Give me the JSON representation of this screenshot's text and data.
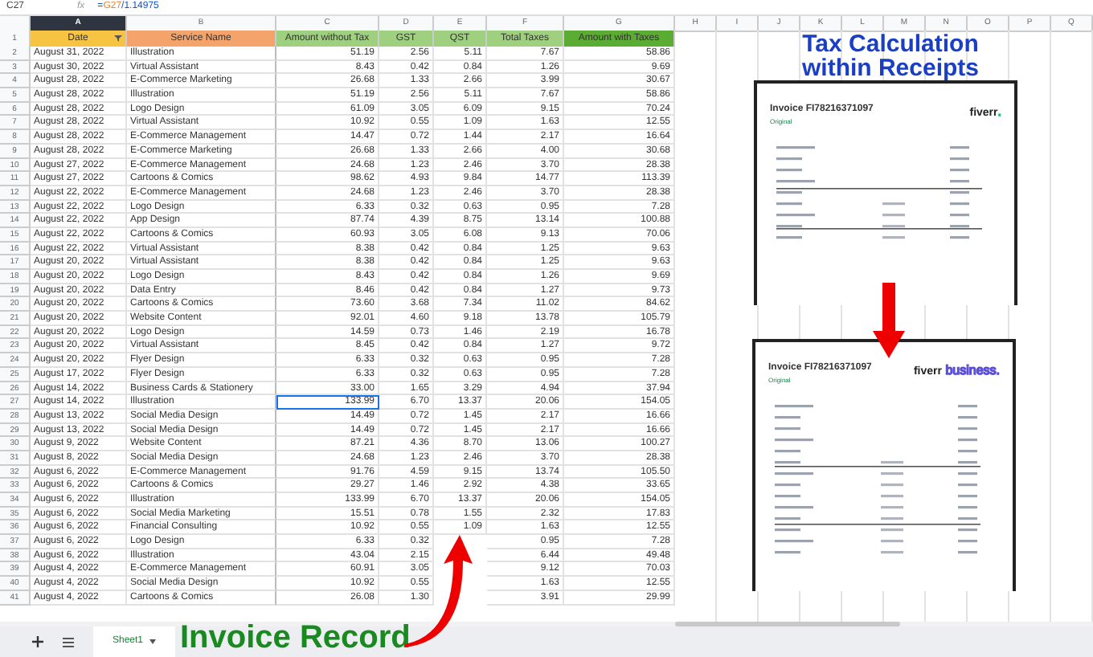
{
  "formula_bar": {
    "cell": "C27",
    "fx": "fx",
    "prefix": "=",
    "reference": "G27",
    "rest": "/1.14975"
  },
  "columns": [
    {
      "label": "A",
      "selected": true
    },
    {
      "label": "B",
      "selected": false
    },
    {
      "label": "C",
      "selected": false
    },
    {
      "label": "D",
      "selected": false
    },
    {
      "label": "E",
      "selected": false
    },
    {
      "label": "F",
      "selected": false
    },
    {
      "label": "G",
      "selected": false
    },
    {
      "label": "H",
      "selected": false
    },
    {
      "label": "I",
      "selected": false
    },
    {
      "label": "J",
      "selected": false
    },
    {
      "label": "K",
      "selected": false
    },
    {
      "label": "L",
      "selected": false
    },
    {
      "label": "M",
      "selected": false
    },
    {
      "label": "N",
      "selected": false
    },
    {
      "label": "O",
      "selected": false
    },
    {
      "label": "P",
      "selected": false
    },
    {
      "label": "Q",
      "selected": false
    }
  ],
  "header_row": {
    "number": "1",
    "cells": [
      {
        "text": "Date",
        "color": "#f6c343",
        "filter": true
      },
      {
        "text": "Service Name",
        "color": "#f4a36b",
        "filter": false
      },
      {
        "text": "Amount without Tax",
        "color": "#9fd07f",
        "filter": false
      },
      {
        "text": "GST",
        "color": "#9fd07f",
        "filter": false
      },
      {
        "text": "QST",
        "color": "#9fd07f",
        "filter": false
      },
      {
        "text": "Total Taxes",
        "color": "#9fd07f",
        "filter": false
      },
      {
        "text": "Amount with Taxes",
        "color": "#5aac32",
        "filter": false
      }
    ]
  },
  "rows": [
    {
      "number": "2",
      "date": "August 31, 2022",
      "service": "Illustration",
      "amount": "51.19",
      "gst": "2.56",
      "qst": "5.11",
      "total_taxes": "7.67",
      "with_taxes": "58.86",
      "selected": false
    },
    {
      "number": "3",
      "date": "August 30, 2022",
      "service": "Virtual Assistant",
      "amount": "8.43",
      "gst": "0.42",
      "qst": "0.84",
      "total_taxes": "1.26",
      "with_taxes": "9.69",
      "selected": false
    },
    {
      "number": "4",
      "date": "August 28, 2022",
      "service": "E-Commerce Marketing",
      "amount": "26.68",
      "gst": "1.33",
      "qst": "2.66",
      "total_taxes": "3.99",
      "with_taxes": "30.67",
      "selected": false
    },
    {
      "number": "5",
      "date": "August 28, 2022",
      "service": "Illustration",
      "amount": "51.19",
      "gst": "2.56",
      "qst": "5.11",
      "total_taxes": "7.67",
      "with_taxes": "58.86",
      "selected": false
    },
    {
      "number": "6",
      "date": "August 28, 2022",
      "service": "Logo Design",
      "amount": "61.09",
      "gst": "3.05",
      "qst": "6.09",
      "total_taxes": "9.15",
      "with_taxes": "70.24",
      "selected": false
    },
    {
      "number": "7",
      "date": "August 28, 2022",
      "service": "Virtual Assistant",
      "amount": "10.92",
      "gst": "0.55",
      "qst": "1.09",
      "total_taxes": "1.63",
      "with_taxes": "12.55",
      "selected": false
    },
    {
      "number": "8",
      "date": "August 28, 2022",
      "service": "E-Commerce Management",
      "amount": "14.47",
      "gst": "0.72",
      "qst": "1.44",
      "total_taxes": "2.17",
      "with_taxes": "16.64",
      "selected": false
    },
    {
      "number": "9",
      "date": "August 28, 2022",
      "service": "E-Commerce Marketing",
      "amount": "26.68",
      "gst": "1.33",
      "qst": "2.66",
      "total_taxes": "4.00",
      "with_taxes": "30.68",
      "selected": false
    },
    {
      "number": "10",
      "date": "August 27, 2022",
      "service": "E-Commerce Management",
      "amount": "24.68",
      "gst": "1.23",
      "qst": "2.46",
      "total_taxes": "3.70",
      "with_taxes": "28.38",
      "selected": false
    },
    {
      "number": "11",
      "date": "August 27, 2022",
      "service": "Cartoons & Comics",
      "amount": "98.62",
      "gst": "4.93",
      "qst": "9.84",
      "total_taxes": "14.77",
      "with_taxes": "113.39",
      "selected": false
    },
    {
      "number": "12",
      "date": "August 22, 2022",
      "service": "E-Commerce Management",
      "amount": "24.68",
      "gst": "1.23",
      "qst": "2.46",
      "total_taxes": "3.70",
      "with_taxes": "28.38",
      "selected": false
    },
    {
      "number": "13",
      "date": "August 22, 2022",
      "service": "Logo Design",
      "amount": "6.33",
      "gst": "0.32",
      "qst": "0.63",
      "total_taxes": "0.95",
      "with_taxes": "7.28",
      "selected": false
    },
    {
      "number": "14",
      "date": "August 22, 2022",
      "service": "App Design",
      "amount": "87.74",
      "gst": "4.39",
      "qst": "8.75",
      "total_taxes": "13.14",
      "with_taxes": "100.88",
      "selected": false
    },
    {
      "number": "15",
      "date": "August 22, 2022",
      "service": "Cartoons & Comics",
      "amount": "60.93",
      "gst": "3.05",
      "qst": "6.08",
      "total_taxes": "9.13",
      "with_taxes": "70.06",
      "selected": false
    },
    {
      "number": "16",
      "date": "August 22, 2022",
      "service": "Virtual Assistant",
      "amount": "8.38",
      "gst": "0.42",
      "qst": "0.84",
      "total_taxes": "1.25",
      "with_taxes": "9.63",
      "selected": false
    },
    {
      "number": "17",
      "date": "August 20, 2022",
      "service": "Virtual Assistant",
      "amount": "8.38",
      "gst": "0.42",
      "qst": "0.84",
      "total_taxes": "1.25",
      "with_taxes": "9.63",
      "selected": false
    },
    {
      "number": "18",
      "date": "August 20, 2022",
      "service": "Logo Design",
      "amount": "8.43",
      "gst": "0.42",
      "qst": "0.84",
      "total_taxes": "1.26",
      "with_taxes": "9.69",
      "selected": false
    },
    {
      "number": "19",
      "date": "August 20, 2022",
      "service": "Data Entry",
      "amount": "8.46",
      "gst": "0.42",
      "qst": "0.84",
      "total_taxes": "1.27",
      "with_taxes": "9.73",
      "selected": false
    },
    {
      "number": "20",
      "date": "August 20, 2022",
      "service": "Cartoons & Comics",
      "amount": "73.60",
      "gst": "3.68",
      "qst": "7.34",
      "total_taxes": "11.02",
      "with_taxes": "84.62",
      "selected": false
    },
    {
      "number": "21",
      "date": "August 20, 2022",
      "service": "Website Content",
      "amount": "92.01",
      "gst": "4.60",
      "qst": "9.18",
      "total_taxes": "13.78",
      "with_taxes": "105.79",
      "selected": false
    },
    {
      "number": "22",
      "date": "August 20, 2022",
      "service": "Logo Design",
      "amount": "14.59",
      "gst": "0.73",
      "qst": "1.46",
      "total_taxes": "2.19",
      "with_taxes": "16.78",
      "selected": false
    },
    {
      "number": "23",
      "date": "August 20, 2022",
      "service": "Virtual Assistant",
      "amount": "8.45",
      "gst": "0.42",
      "qst": "0.84",
      "total_taxes": "1.27",
      "with_taxes": "9.72",
      "selected": false
    },
    {
      "number": "24",
      "date": "August 20, 2022",
      "service": "Flyer Design",
      "amount": "6.33",
      "gst": "0.32",
      "qst": "0.63",
      "total_taxes": "0.95",
      "with_taxes": "7.28",
      "selected": false
    },
    {
      "number": "25",
      "date": "August 17, 2022",
      "service": "Flyer Design",
      "amount": "6.33",
      "gst": "0.32",
      "qst": "0.63",
      "total_taxes": "0.95",
      "with_taxes": "7.28",
      "selected": false
    },
    {
      "number": "26",
      "date": "August 14, 2022",
      "service": "Business Cards & Stationery",
      "amount": "33.00",
      "gst": "1.65",
      "qst": "3.29",
      "total_taxes": "4.94",
      "with_taxes": "37.94",
      "selected": false
    },
    {
      "number": "27",
      "date": "August 14, 2022",
      "service": "Illustration",
      "amount": "133.99",
      "gst": "6.70",
      "qst": "13.37",
      "total_taxes": "20.06",
      "with_taxes": "154.05",
      "selected": true
    },
    {
      "number": "28",
      "date": "August 13, 2022",
      "service": "Social Media Design",
      "amount": "14.49",
      "gst": "0.72",
      "qst": "1.45",
      "total_taxes": "2.17",
      "with_taxes": "16.66",
      "selected": false
    },
    {
      "number": "29",
      "date": "August 13, 2022",
      "service": "Social Media Design",
      "amount": "14.49",
      "gst": "0.72",
      "qst": "1.45",
      "total_taxes": "2.17",
      "with_taxes": "16.66",
      "selected": false
    },
    {
      "number": "30",
      "date": "August 9, 2022",
      "service": "Website Content",
      "amount": "87.21",
      "gst": "4.36",
      "qst": "8.70",
      "total_taxes": "13.06",
      "with_taxes": "100.27",
      "selected": false
    },
    {
      "number": "31",
      "date": "August 8, 2022",
      "service": "Social Media Design",
      "amount": "24.68",
      "gst": "1.23",
      "qst": "2.46",
      "total_taxes": "3.70",
      "with_taxes": "28.38",
      "selected": false
    },
    {
      "number": "32",
      "date": "August 6, 2022",
      "service": "E-Commerce Management",
      "amount": "91.76",
      "gst": "4.59",
      "qst": "9.15",
      "total_taxes": "13.74",
      "with_taxes": "105.50",
      "selected": false
    },
    {
      "number": "33",
      "date": "August 6, 2022",
      "service": "Cartoons & Comics",
      "amount": "29.27",
      "gst": "1.46",
      "qst": "2.92",
      "total_taxes": "4.38",
      "with_taxes": "33.65",
      "selected": false
    },
    {
      "number": "34",
      "date": "August 6, 2022",
      "service": "Illustration",
      "amount": "133.99",
      "gst": "6.70",
      "qst": "13.37",
      "total_taxes": "20.06",
      "with_taxes": "154.05",
      "selected": false
    },
    {
      "number": "35",
      "date": "August 6, 2022",
      "service": "Social Media Marketing",
      "amount": "15.51",
      "gst": "0.78",
      "qst": "1.55",
      "total_taxes": "2.32",
      "with_taxes": "17.83",
      "selected": false
    },
    {
      "number": "36",
      "date": "August 6, 2022",
      "service": "Financial Consulting",
      "amount": "10.92",
      "gst": "0.55",
      "qst": "1.09",
      "total_taxes": "1.63",
      "with_taxes": "12.55",
      "selected": false
    },
    {
      "number": "37",
      "date": "August 6, 2022",
      "service": "Logo Design",
      "amount": "6.33",
      "gst": "0.32",
      "total_taxes": "0.95",
      "with_taxes": "7.28",
      "selected": false
    },
    {
      "number": "38",
      "date": "August 6, 2022",
      "service": "Illustration",
      "amount": "43.04",
      "gst": "2.15",
      "total_taxes": "6.44",
      "with_taxes": "49.48",
      "selected": false
    },
    {
      "number": "39",
      "date": "August 4, 2022",
      "service": "E-Commerce Management",
      "amount": "60.91",
      "gst": "3.05",
      "total_taxes": "9.12",
      "with_taxes": "70.03",
      "selected": false
    },
    {
      "number": "40",
      "date": "August 4, 2022",
      "service": "Social Media Design",
      "amount": "10.92",
      "gst": "0.55",
      "total_taxes": "1.63",
      "with_taxes": "12.55",
      "selected": false
    },
    {
      "number": "41",
      "date": "August 4, 2022",
      "service": "Cartoons & Comics",
      "amount": "26.08",
      "gst": "1.30",
      "total_taxes": "3.91",
      "with_taxes": "29.99",
      "selected": false
    }
  ],
  "sheet_tabs": [
    {
      "label": "Sheet1",
      "selected": true
    }
  ],
  "heading": "Tax Calculation within Receipts",
  "receipts": [
    {
      "title": "Invoice FI78216371097",
      "subtitle": "Original",
      "logo": "fiverr",
      "logo_suffix": ".",
      "color": "#1dbf73"
    },
    {
      "title": "Invoice FI78216371097",
      "subtitle": "Original",
      "logo": "fiverr",
      "logo_suffix": " business.",
      "color": "#5b4fd6"
    }
  ],
  "caption": "Invoice Record"
}
